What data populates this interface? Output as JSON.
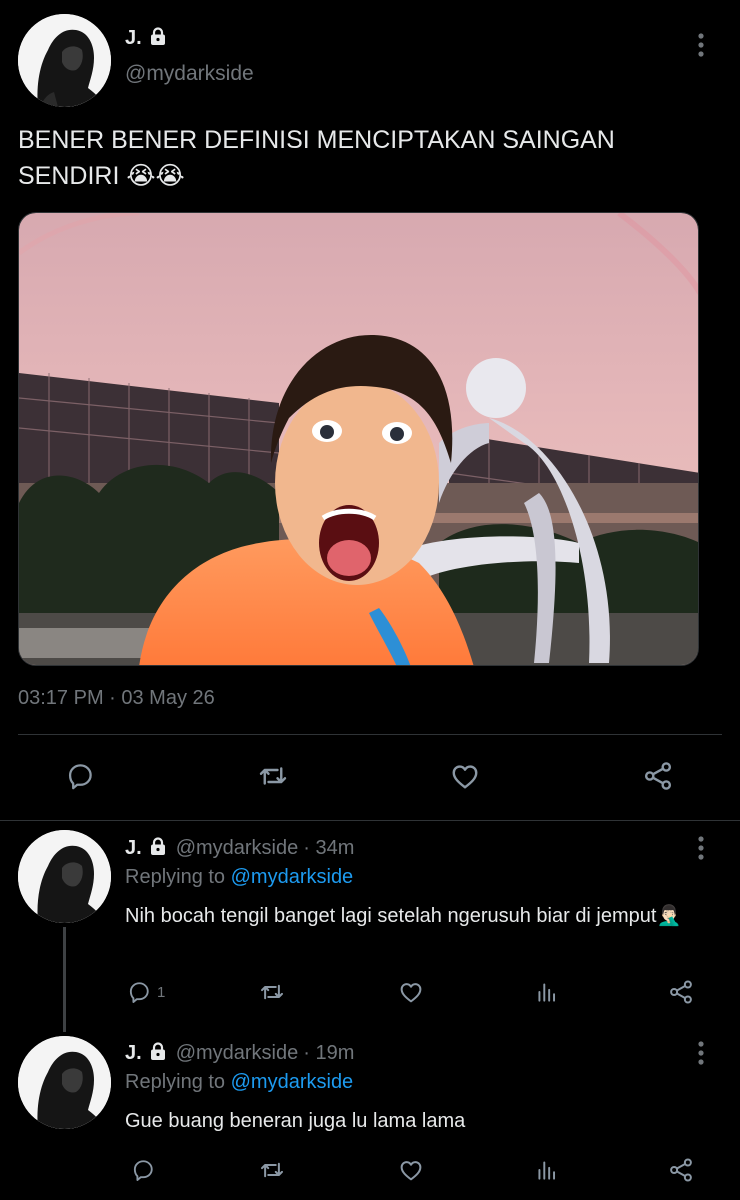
{
  "main_tweet": {
    "display_name": "J.",
    "handle": "@mydarkside",
    "text": "BENER BENER DEFINISI MENCIPTAKAN SAINGAN SENDIRI 😭😭",
    "timestamp": "03:17 PM · 03 May 26"
  },
  "replies": [
    {
      "display_name": "J.",
      "handle": "@mydarkside",
      "age": "· 34m",
      "replying_prefix": "Replying to",
      "replying_to": "@mydarkside",
      "text": "Nih bocah tengil banget lagi setelah ngerusuh biar di jemput🤦🏻‍♂️",
      "reply_count": "1"
    },
    {
      "display_name": "J.",
      "handle": "@mydarkside",
      "age": "· 19m",
      "replying_prefix": "Replying to",
      "replying_to": "@mydarkside",
      "text": "Gue buang beneran juga lu lama lama",
      "reply_count": ""
    }
  ],
  "icons": {
    "reply": "reply-icon",
    "retweet": "retweet-icon",
    "like": "heart-icon",
    "share": "share-icon",
    "analytics": "analytics-icon",
    "more": "more-vertical-icon",
    "lock": "lock-icon"
  },
  "colors": {
    "background": "#000000",
    "text": "#e7e9ea",
    "secondary": "#71767b",
    "link": "#1d9bf0",
    "divider": "#2f3336"
  }
}
